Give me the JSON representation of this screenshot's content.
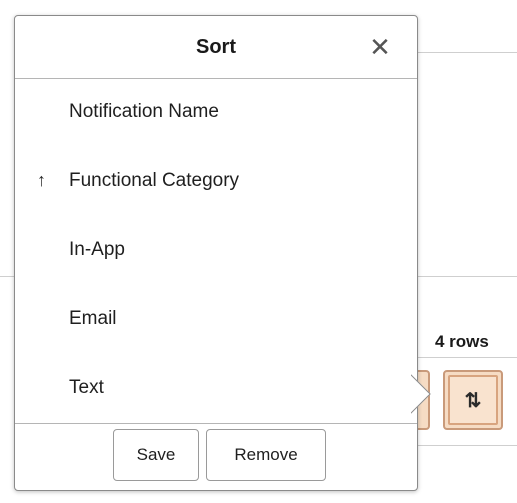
{
  "background": {
    "rows_count": "4 rows",
    "sort_button_symbol": "⇅"
  },
  "popup": {
    "title": "Sort",
    "close_symbol": "✕",
    "items": [
      {
        "label": "Notification Name",
        "arrow": ""
      },
      {
        "label": "Functional Category",
        "arrow": "↑"
      },
      {
        "label": "In-App",
        "arrow": ""
      },
      {
        "label": "Email",
        "arrow": ""
      },
      {
        "label": "Text",
        "arrow": ""
      }
    ],
    "save_label": "Save",
    "remove_label": "Remove"
  },
  "colors": {
    "accent_fill": "#f6dcc4",
    "accent_border": "#c99a7a"
  }
}
